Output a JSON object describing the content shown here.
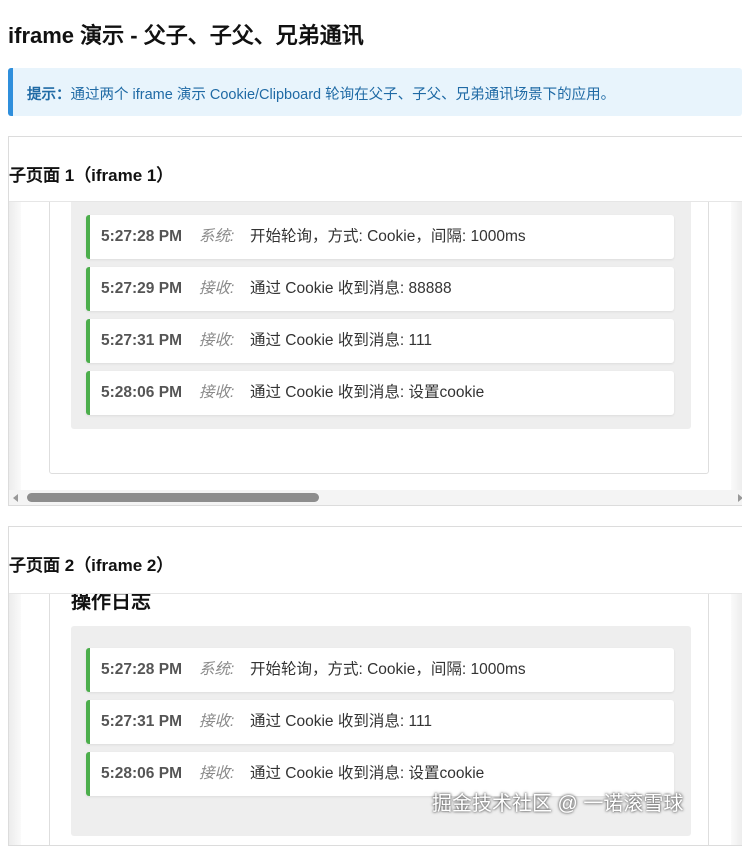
{
  "page": {
    "title": "iframe 演示 - 父子、子父、兄弟通讯"
  },
  "tip": {
    "label": "提示：",
    "text": "通过两个 iframe 演示 Cookie/Clipboard 轮询在父子、子父、兄弟通讯场景下的应用。",
    "accent": "#2f8fdc"
  },
  "frames": [
    {
      "title": "子页面 1（iframe 1）",
      "log": [
        {
          "time": "5:27:28 PM",
          "type": "系统:",
          "message": "开始轮询，方式: Cookie，间隔: 1000ms"
        },
        {
          "time": "5:27:29 PM",
          "type": "接收:",
          "message": "通过 Cookie 收到消息: 88888"
        },
        {
          "time": "5:27:31 PM",
          "type": "接收:",
          "message": "通过 Cookie 收到消息: 111"
        },
        {
          "time": "5:28:06 PM",
          "type": "接收:",
          "message": "通过 Cookie 收到消息: 设置cookie"
        }
      ]
    },
    {
      "title": "子页面 2（iframe 2）",
      "heading": "操作日志",
      "log": [
        {
          "time": "5:27:28 PM",
          "type": "系统:",
          "message": "开始轮询，方式: Cookie，间隔: 1000ms"
        },
        {
          "time": "5:27:31 PM",
          "type": "接收:",
          "message": "通过 Cookie 收到消息: 111"
        },
        {
          "time": "5:28:06 PM",
          "type": "接收:",
          "message": "通过 Cookie 收到消息: 设置cookie"
        }
      ]
    }
  ],
  "colors": {
    "log_border": "#4cae4c",
    "tip_bg": "#e8f4fc"
  },
  "watermark": "掘金技术社区 @ 一诺滚雪球"
}
